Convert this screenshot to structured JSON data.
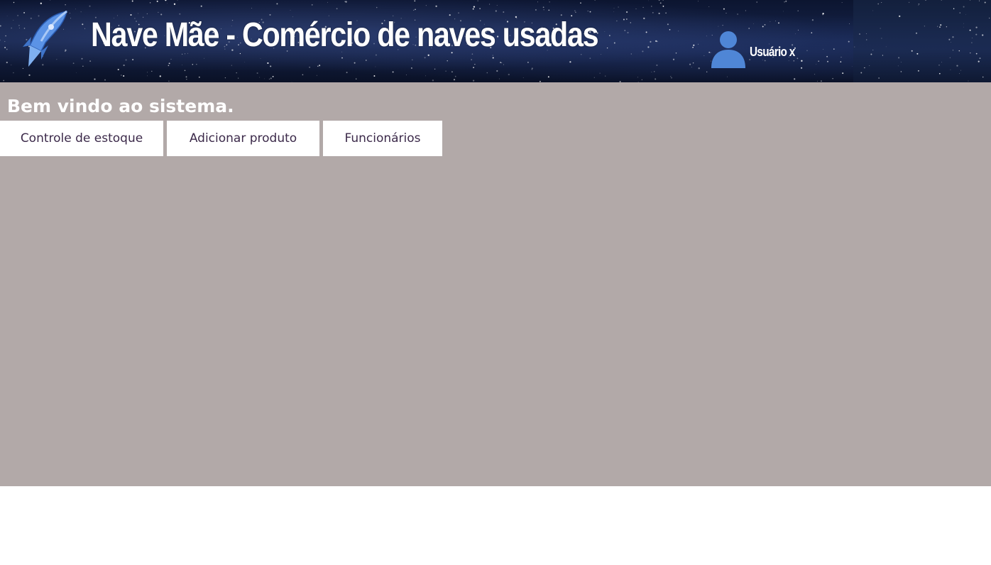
{
  "header": {
    "title": "Nave Mãe - Comércio de naves usadas",
    "logo_icon": "rocket-icon",
    "user": {
      "icon": "user-avatar-icon",
      "name": "Usuário x"
    }
  },
  "main": {
    "welcome": "Bem vindo ao sistema.",
    "nav": {
      "items": [
        {
          "label": "Controle de estoque"
        },
        {
          "label": "Adicionar produto"
        },
        {
          "label": "Funcionários"
        }
      ]
    }
  },
  "colors": {
    "content_background": "#b2a9a8",
    "header_background": "#16244a",
    "button_background": "#ffffff",
    "button_text": "#3c2a4a",
    "accent_blue": "#4f86d6"
  }
}
